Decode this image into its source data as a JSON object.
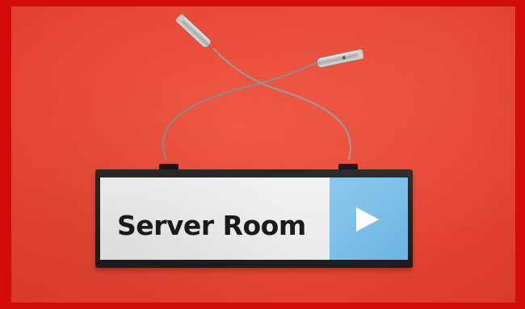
{
  "sign": {
    "label": "Server Room",
    "arrow_panel_color": "#77bde6",
    "text_color": "#1b1b1b"
  },
  "photo": {
    "background_color": "#e94a38",
    "border_color": "#d30b0b"
  },
  "icons": {
    "arrow": "play-icon"
  }
}
